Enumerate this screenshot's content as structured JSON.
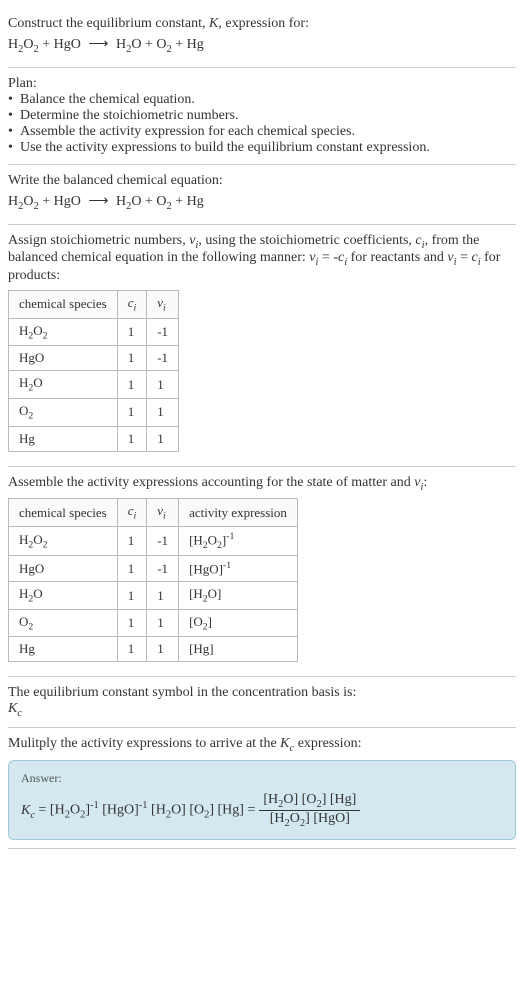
{
  "sections": {
    "construct": {
      "line1": "Construct the equilibrium constant, K, expression for:",
      "equation_reactant1": "H₂O₂",
      "equation_reactant2": "HgO",
      "equation_product1": "H₂O",
      "equation_product2": "O₂",
      "equation_product3": "Hg"
    },
    "plan": {
      "heading": "Plan:",
      "bullets": [
        "Balance the chemical equation.",
        "Determine the stoichiometric numbers.",
        "Assemble the activity expression for each chemical species.",
        "Use the activity expressions to build the equilibrium constant expression."
      ]
    },
    "balanced": {
      "heading": "Write the balanced chemical equation:"
    },
    "assign": {
      "text_pre": "Assign stoichiometric numbers, νᵢ, using the stoichiometric coefficients, cᵢ, from the balanced chemical equation in the following manner: νᵢ = -cᵢ for reactants and νᵢ = cᵢ for products:",
      "table": {
        "headers": [
          "chemical species",
          "cᵢ",
          "νᵢ"
        ],
        "rows": [
          [
            "H₂O₂",
            "1",
            "-1"
          ],
          [
            "HgO",
            "1",
            "-1"
          ],
          [
            "H₂O",
            "1",
            "1"
          ],
          [
            "O₂",
            "1",
            "1"
          ],
          [
            "Hg",
            "1",
            "1"
          ]
        ]
      }
    },
    "assemble": {
      "heading": "Assemble the activity expressions accounting for the state of matter and νᵢ:",
      "table": {
        "headers": [
          "chemical species",
          "cᵢ",
          "νᵢ",
          "activity expression"
        ],
        "rows": [
          {
            "species": "H₂O₂",
            "ci": "1",
            "vi": "-1",
            "expr": "[H₂O₂]⁻¹"
          },
          {
            "species": "HgO",
            "ci": "1",
            "vi": "-1",
            "expr": "[HgO]⁻¹"
          },
          {
            "species": "H₂O",
            "ci": "1",
            "vi": "1",
            "expr": "[H₂O]"
          },
          {
            "species": "O₂",
            "ci": "1",
            "vi": "1",
            "expr": "[O₂]"
          },
          {
            "species": "Hg",
            "ci": "1",
            "vi": "1",
            "expr": "[Hg]"
          }
        ]
      }
    },
    "symbol": {
      "line1": "The equilibrium constant symbol in the concentration basis is:",
      "line2": "K_c"
    },
    "multiply": {
      "heading": "Mulitply the activity expressions to arrive at the K_c expression:"
    },
    "answer": {
      "label": "Answer:",
      "lhs": "K_c = ",
      "mid": "[H₂O₂]⁻¹ [HgO]⁻¹ [H₂O] [O₂] [Hg] = ",
      "frac_num": "[H₂O] [O₂] [Hg]",
      "frac_den": "[H₂O₂] [HgO]"
    }
  }
}
